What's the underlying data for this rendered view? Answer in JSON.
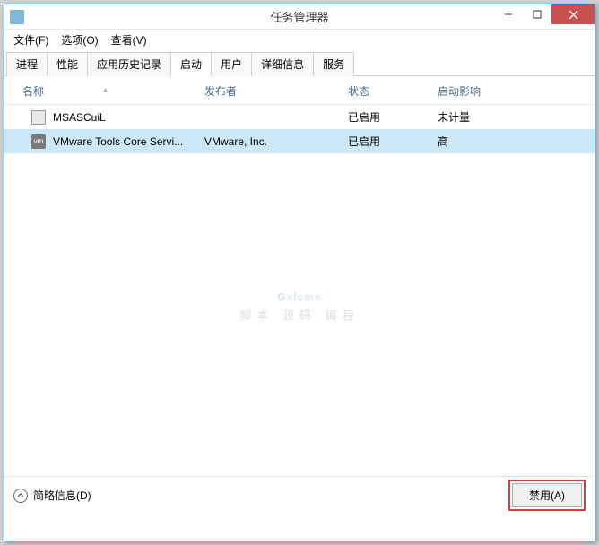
{
  "window": {
    "title": "任务管理器"
  },
  "menu": {
    "file": "文件(F)",
    "options": "选项(O)",
    "view": "查看(V)"
  },
  "tabs": {
    "processes": "进程",
    "performance": "性能",
    "history": "应用历史记录",
    "startup": "启动",
    "users": "用户",
    "details": "详细信息",
    "services": "服务"
  },
  "columns": {
    "name": "名称",
    "publisher": "发布者",
    "status": "状态",
    "impact": "启动影响"
  },
  "rows": [
    {
      "name": "MSASCuiL",
      "publisher": "",
      "status": "已启用",
      "impact": "未计量",
      "iconType": "ms",
      "selected": false
    },
    {
      "name": "VMware Tools Core Servi...",
      "publisher": "VMware, Inc.",
      "status": "已启用",
      "impact": "高",
      "iconType": "vm",
      "selected": true
    }
  ],
  "footer": {
    "fewer": "简略信息(D)",
    "disable": "禁用(A)"
  },
  "watermark": {
    "big": "Gxlcms",
    "small": "脚本 源码 编程"
  }
}
